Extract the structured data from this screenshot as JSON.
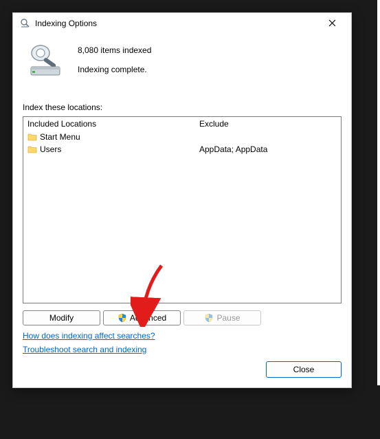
{
  "title": "Indexing Options",
  "items_indexed": "8,080 items indexed",
  "status": "Indexing complete.",
  "section_label": "Index these locations:",
  "columns": {
    "included": "Included Locations",
    "exclude": "Exclude"
  },
  "rows": [
    {
      "name": "Start Menu",
      "exclude": ""
    },
    {
      "name": "Users",
      "exclude": "AppData; AppData"
    }
  ],
  "buttons": {
    "modify": "Modify",
    "advanced": "Advanced",
    "pause": "Pause",
    "close": "Close"
  },
  "links": {
    "how": "How does indexing affect searches?",
    "troubleshoot": "Troubleshoot search and indexing"
  }
}
